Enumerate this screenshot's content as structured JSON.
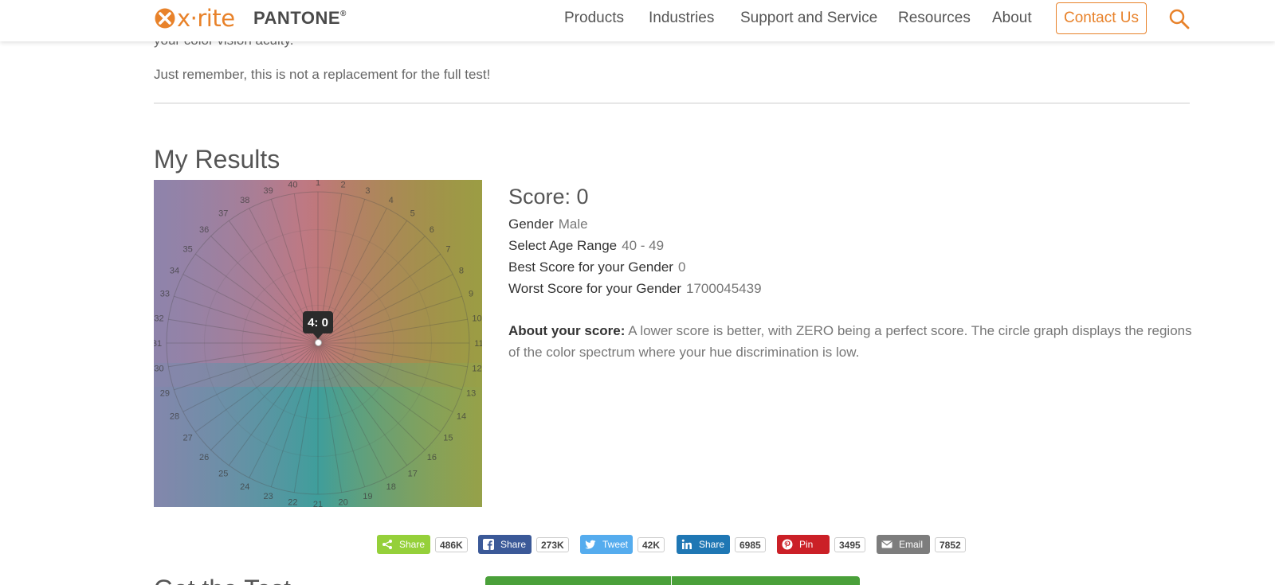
{
  "header": {
    "logo_text": "x·rite",
    "brand": "PANTONE",
    "brand_mark": "®",
    "nav": [
      "Products",
      "Industries",
      "Support and Service",
      "Resources",
      "About"
    ],
    "contact": "Contact Us",
    "accent": "#e8822a"
  },
  "intro": {
    "cut_text": "your color vision acuity.",
    "line": "Just remember, this is not a replacement for the full test!"
  },
  "results": {
    "title": "My Results",
    "wheel": {
      "labels": [
        "1",
        "2",
        "3",
        "4",
        "5",
        "6",
        "7",
        "8",
        "9",
        "10",
        "11",
        "12",
        "13",
        "14",
        "15",
        "16",
        "17",
        "18",
        "19",
        "20",
        "21",
        "22",
        "23",
        "24",
        "25",
        "26",
        "27",
        "28",
        "29",
        "30",
        "31",
        "32",
        "33",
        "34",
        "35",
        "36",
        "37",
        "38",
        "39",
        "40"
      ],
      "tooltip": "4: 0"
    },
    "score": "Score: 0",
    "gender_label": "Gender",
    "gender_value": "Male",
    "age_label": "Select Age Range",
    "age_value": "40 - 49",
    "best_label": "Best Score for your Gender",
    "best_value": "0",
    "worst_label": "Worst Score for your Gender",
    "worst_value": "1700045439",
    "about_label": "About your score:",
    "about_text": "A lower score is better, with ZERO being a perfect score. The circle graph displays the regions of the color spectrum where your hue discrimination is low."
  },
  "share": [
    {
      "label": "Share",
      "count": "486K",
      "color": "#95d03a",
      "icon": "share-icon"
    },
    {
      "label": "Share",
      "count": "273K",
      "color": "#3b5998",
      "icon": "facebook-icon"
    },
    {
      "label": "Tweet",
      "count": "42K",
      "color": "#55acee",
      "icon": "twitter-icon"
    },
    {
      "label": "Share",
      "count": "6985",
      "color": "#1f77b4",
      "icon": "linkedin-icon"
    },
    {
      "label": "Pin",
      "count": "3495",
      "color": "#cb2027",
      "icon": "pinterest-icon"
    },
    {
      "label": "Email",
      "count": "7852",
      "color": "#7d7d7d",
      "icon": "email-icon"
    }
  ],
  "bottom": {
    "title": "Get the Test"
  }
}
